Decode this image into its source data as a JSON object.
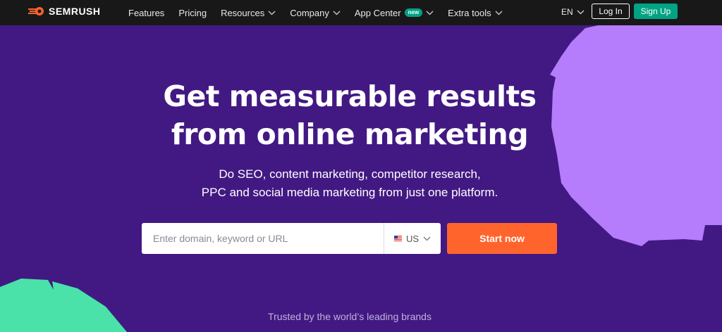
{
  "brand": {
    "name": "SEMRUSH",
    "logo_icon": "semrush-flame-icon",
    "accent_color": "#ff642d",
    "background_color": "#421983",
    "secondary_color": "#00a383"
  },
  "nav": {
    "items": [
      {
        "label": "Features",
        "has_dropdown": false
      },
      {
        "label": "Pricing",
        "has_dropdown": false
      },
      {
        "label": "Resources",
        "has_dropdown": true
      },
      {
        "label": "Company",
        "has_dropdown": true
      },
      {
        "label": "App Center",
        "has_dropdown": true,
        "badge": "new"
      },
      {
        "label": "Extra tools",
        "has_dropdown": true
      }
    ],
    "language": "EN",
    "login_label": "Log In",
    "signup_label": "Sign Up"
  },
  "hero": {
    "title_line1": "Get measurable results",
    "title_line2": "from online marketing",
    "subtitle_line1": "Do SEO, content marketing, competitor research,",
    "subtitle_line2": "PPC and social media marketing from just one platform."
  },
  "search": {
    "placeholder": "Enter domain, keyword or URL",
    "value": "",
    "country": "US",
    "country_icon": "us-flag-icon",
    "submit_label": "Start now"
  },
  "footer": {
    "trusted_text": "Trusted by the world’s leading brands"
  }
}
